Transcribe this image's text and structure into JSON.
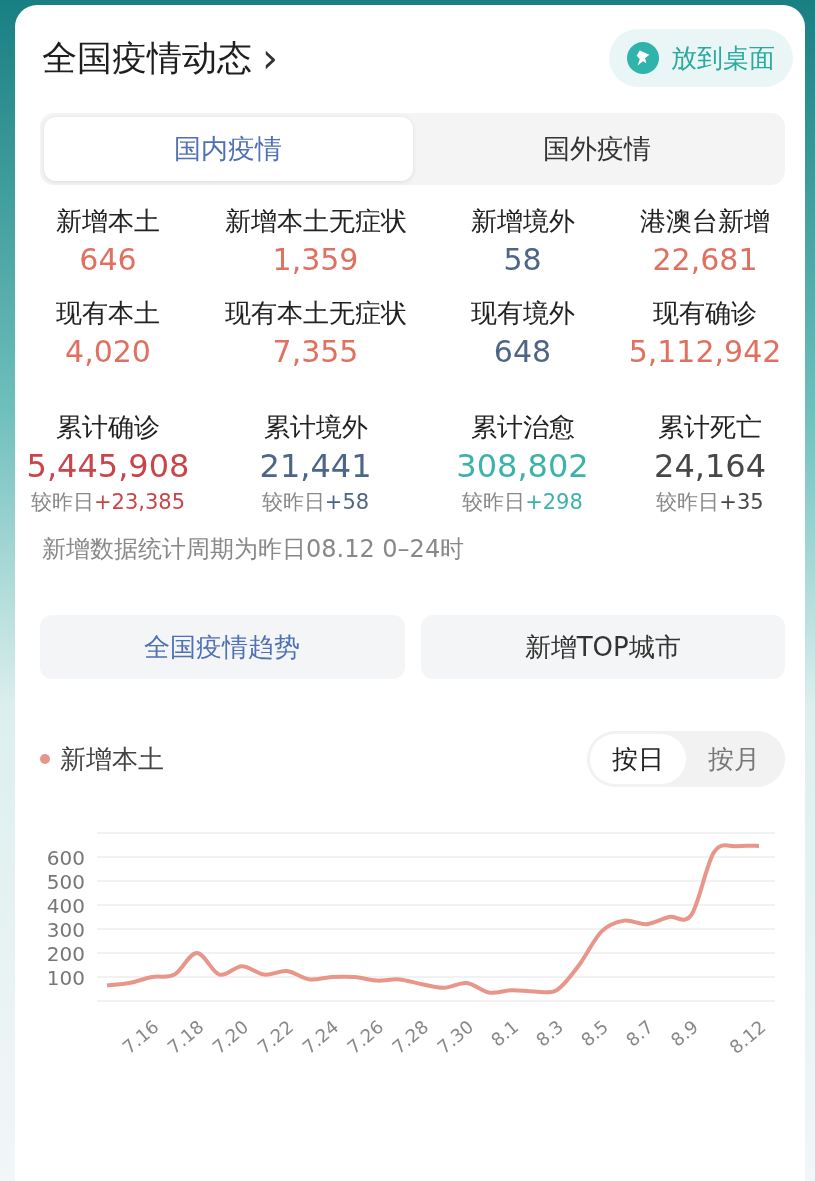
{
  "header": {
    "title": "全国疫情动态",
    "chevron": "›",
    "desktop_button": "放到桌面"
  },
  "tabs": [
    {
      "label": "国内疫情",
      "selected": true
    },
    {
      "label": "国外疫情",
      "selected": false
    }
  ],
  "stats": [
    {
      "label": "新增本土",
      "value": "646",
      "color": "#e0705f"
    },
    {
      "label": "新增本土无症状",
      "value": "1,359",
      "color": "#e0705f"
    },
    {
      "label": "新增境外",
      "value": "58",
      "color": "#4d6587"
    },
    {
      "label": "港澳台新增",
      "value": "22,681",
      "color": "#e0705f"
    },
    {
      "label": "现有本土",
      "value": "4,020",
      "color": "#e0705f"
    },
    {
      "label": "现有本土无症状",
      "value": "7,355",
      "color": "#e0705f"
    },
    {
      "label": "现有境外",
      "value": "648",
      "color": "#4d6587"
    },
    {
      "label": "现有确诊",
      "value": "5,112,942",
      "color": "#e0705f"
    }
  ],
  "totals": [
    {
      "label": "累计确诊",
      "value": "5,445,908",
      "diff_label": "较昨日",
      "diff": "+23,385",
      "color": "#c8454a"
    },
    {
      "label": "累计境外",
      "value": "21,441",
      "diff_label": "较昨日",
      "diff": "+58",
      "color": "#4d6587"
    },
    {
      "label": "累计治愈",
      "value": "308,802",
      "diff_label": "较昨日",
      "diff": "+298",
      "color": "#3bb3aa"
    },
    {
      "label": "累计死亡",
      "value": "24,164",
      "diff_label": "较昨日",
      "diff": "+35",
      "color": "#474747"
    }
  ],
  "note": "新增数据统计周期为昨日08.12 0–24时",
  "sections": [
    {
      "label": "全国疫情趋势",
      "selected": true
    },
    {
      "label": "新增TOP城市",
      "selected": false
    }
  ],
  "periods": [
    {
      "label": "按日",
      "selected": true
    },
    {
      "label": "按月",
      "selected": false
    }
  ],
  "chart_data": {
    "type": "line",
    "categories": [
      null,
      null,
      "7.16",
      null,
      "7.18",
      null,
      "7.20",
      null,
      "7.22",
      null,
      "7.24",
      null,
      "7.26",
      null,
      "7.28",
      null,
      "7.30",
      null,
      "8.1",
      null,
      "8.3",
      null,
      "8.5",
      null,
      "8.7",
      null,
      "8.9",
      null,
      null,
      "8.12"
    ],
    "series": [
      {
        "name": "新增本土",
        "color": "#e8958a",
        "values": [
          65,
          75,
          100,
          110,
          200,
          110,
          145,
          110,
          125,
          90,
          100,
          100,
          85,
          90,
          70,
          55,
          75,
          35,
          45,
          40,
          45,
          150,
          290,
          335,
          320,
          350,
          360,
          620,
          645,
          646
        ]
      }
    ],
    "grid": true,
    "yticks": [
      100,
      200,
      300,
      400,
      500,
      600
    ],
    "ylim": [
      0,
      700
    ]
  }
}
